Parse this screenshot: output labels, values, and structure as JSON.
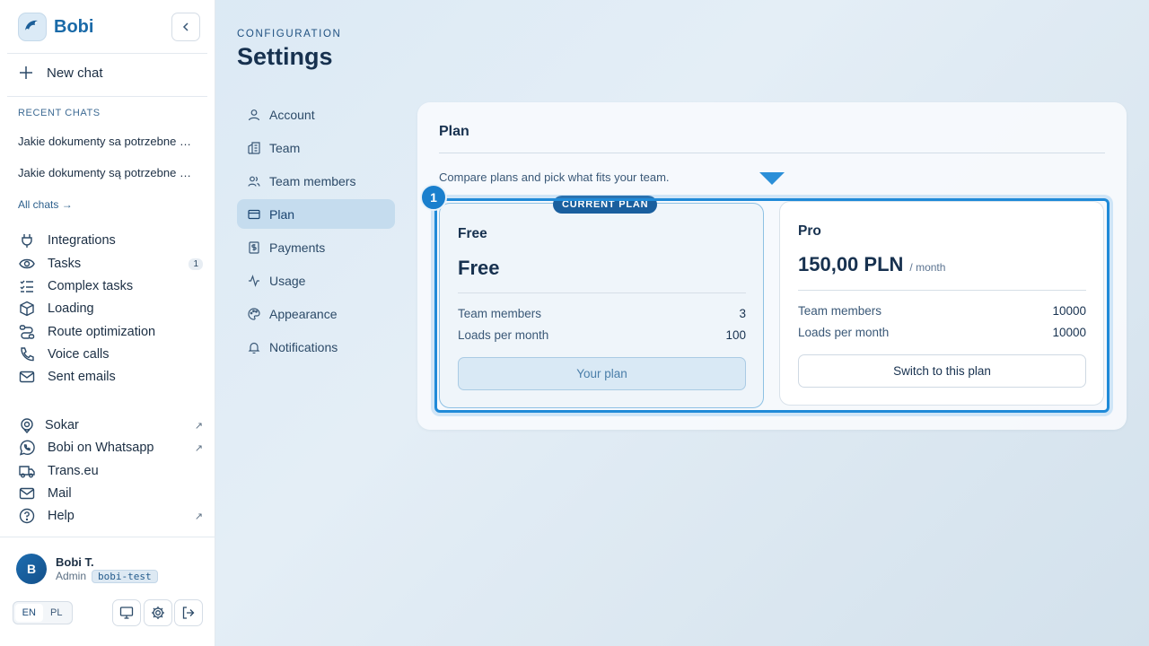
{
  "brand": {
    "name": "Bobi"
  },
  "sidebar": {
    "new_chat": "New chat",
    "recent_label": "RECENT CHATS",
    "recent_chats": [
      "Jakie dokumenty sa potrzebne przy transporcie",
      "Jakie dokumenty są potrzebne przy transporcie"
    ],
    "all_chats": "All chats",
    "all_chats_arrow": "→",
    "tools": [
      {
        "label": "Integrations",
        "icon": "plug-icon"
      },
      {
        "label": "Tasks",
        "icon": "eye-icon",
        "badge": "1"
      },
      {
        "label": "Complex tasks",
        "icon": "checklist-icon"
      },
      {
        "label": "Loading",
        "icon": "box-icon"
      },
      {
        "label": "Route optimization",
        "icon": "route-icon"
      },
      {
        "label": "Voice calls",
        "icon": "phone-icon"
      },
      {
        "label": "Sent emails",
        "icon": "mail-icon"
      }
    ],
    "links": [
      {
        "label": "Sokar",
        "icon": "location-icon",
        "ext": "↗"
      },
      {
        "label": "Bobi on Whatsapp",
        "icon": "whatsapp-icon",
        "ext": "↗"
      },
      {
        "label": "Trans.eu",
        "icon": "truck-icon"
      },
      {
        "label": "Mail",
        "icon": "mail-icon"
      },
      {
        "label": "Help",
        "icon": "help-icon",
        "ext": "↗"
      }
    ],
    "user": {
      "initial": "B",
      "name": "Bobi T.",
      "role": "Admin",
      "org": "bobi-test"
    },
    "languages": [
      "EN",
      "PL"
    ],
    "active_language": "EN"
  },
  "header": {
    "eyebrow": "CONFIGURATION",
    "title": "Settings"
  },
  "settings_nav": [
    {
      "label": "Account",
      "icon": "user-icon"
    },
    {
      "label": "Team",
      "icon": "building-icon"
    },
    {
      "label": "Team members",
      "icon": "users-icon"
    },
    {
      "label": "Plan",
      "icon": "credit-card-icon",
      "active": true
    },
    {
      "label": "Payments",
      "icon": "receipt-icon"
    },
    {
      "label": "Usage",
      "icon": "activity-icon"
    },
    {
      "label": "Appearance",
      "icon": "palette-icon"
    },
    {
      "label": "Notifications",
      "icon": "bell-icon"
    }
  ],
  "plan_panel": {
    "title": "Plan",
    "description": "Compare plans and pick what fits your team.",
    "step": "1",
    "plans": [
      {
        "name": "Free",
        "price": "Free",
        "period": "",
        "current_tag": "CURRENT PLAN",
        "rows": [
          {
            "label": "Team members",
            "value": "3"
          },
          {
            "label": "Loads per month",
            "value": "100"
          }
        ],
        "button": "Your plan"
      },
      {
        "name": "Pro",
        "price": "150,00 PLN",
        "period": "/ month",
        "rows": [
          {
            "label": "Team members",
            "value": "10000"
          },
          {
            "label": "Loads per month",
            "value": "10000"
          }
        ],
        "button": "Switch to this plan"
      }
    ]
  },
  "colors": {
    "accent": "#1f8ad8",
    "brand": "#1a6aa8",
    "active_nav": "#c5dcee"
  }
}
